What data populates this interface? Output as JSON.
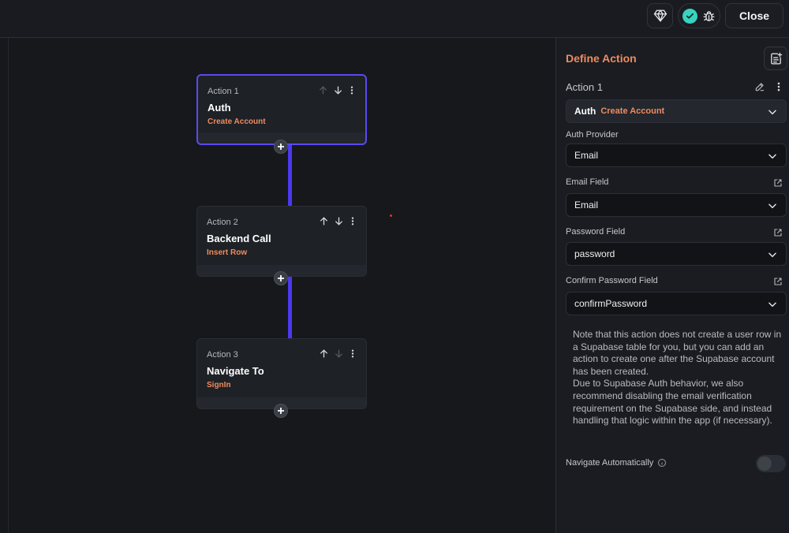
{
  "toolbar": {
    "close_label": "Close",
    "gem_icon": "gem-icon",
    "status_icon": "check-circle-icon",
    "debug_icon": "bug-icon"
  },
  "flow": {
    "actions": [
      {
        "label": "Action 1",
        "title": "Auth",
        "subtitle": "Create Account"
      },
      {
        "label": "Action 2",
        "title": "Backend Call",
        "subtitle": "Insert Row"
      },
      {
        "label": "Action 3",
        "title": "Navigate To",
        "subtitle": "SignIn"
      }
    ]
  },
  "panel": {
    "title": "Define Action",
    "action_name": "Action 1",
    "action_type": "Auth",
    "action_subtype": "Create Account",
    "fields": [
      {
        "label": "Auth Provider",
        "value": "Email"
      },
      {
        "label": "Email Field",
        "value": "Email"
      },
      {
        "label": "Password Field",
        "value": "password"
      },
      {
        "label": "Confirm Password Field",
        "value": "confirmPassword"
      }
    ],
    "note_line1": "Note that this action does not create a user row in a Supabase table for you, but you can add an action to create one after the Supabase account has been created.",
    "note_line2": "Due to Supabase Auth behavior, we also recommend disabling the email verification requirement on the Supabase side, and instead handling that logic within the app (if necessary).",
    "navigate_label": "Navigate Automatically",
    "navigate_enabled": false
  },
  "colors": {
    "accent": "#4b39ef",
    "orange": "#ee8b60",
    "teal": "#39d2c0",
    "background": "#16181c"
  }
}
